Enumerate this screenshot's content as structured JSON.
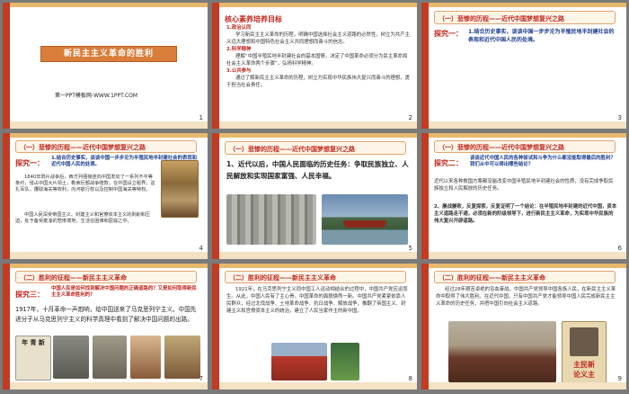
{
  "slides": [
    {
      "num": "1",
      "title": "新民主主义革命的胜利",
      "site": "第一PPT模板网-WWW.1PPT.COM"
    },
    {
      "num": "2",
      "heading": "核心素养培养目标",
      "s1_title": "1.政治认同",
      "s1_body": "学习新民主主义革命的历程，明确中国选择社会主义道路的必然性，树立为共产主义远大理想和中国特色社会主义共同理想而奋斗的信念。",
      "s2_title": "2.科学精神",
      "s2_body": "理解“中国半殖民地半封建社会的基本国情，决定了中国革命必须分为民主革命和社会主义革命两个步骤”，弘扬科学精神。",
      "s3_title": "3.公共参与",
      "s3_body": "通过了解新民主主义革命的历程，树立为实现中华民族伟大复兴而奋斗的理想，勇于担当社会责任。"
    },
    {
      "num": "3",
      "heading": "（一）悲惨的历程——近代中国梦想复兴之路",
      "explore": "探究一：",
      "question": "1.结合历史事实，谈谈中国一步步沦为半殖民地半封建社会的表现和近代中国人民的处境。"
    },
    {
      "num": "4",
      "heading": "（一）悲惨的历程——近代中国梦想复兴之路",
      "explore": "探究一：",
      "question": "1.结合历史事实，谈谈中国一步步沦为半殖民地半封建社会的表现和近代中国人民的处境。",
      "body1": "1840年鸦片战争后，西方列强接连向中国发动了一系列不平等条约，侵占中国大片领土，勒索巨额战争赔款，在中国设立租界，驻扎军队，攫取海关等权利，内河航行权以及控制中国海关等特权。",
      "body2": "中国人民深受帝国主义、封建主义和官僚资本主义的剥削和压迫，处于备受欺凌的悲惨境地，生活在困难和屈辱之中。"
    },
    {
      "num": "5",
      "heading": "（一）悲惨的历程——近代中国梦想复兴之路",
      "body": "1、近代以后，中国人民面临的历史任务：争取民族独立、人民解放和实现国家富强、人民幸福。"
    },
    {
      "num": "6",
      "heading": "（一）悲惨的历程——近代中国梦想复兴之路",
      "explore": "探究二：",
      "question": "谈谈近代中国人民的各种尝试和斗争为什么都没能取得最后的胜利？我们从中可以得出哪些结论？",
      "body": "近代以来各种救国方案都没能改变中国半殖民地半封建社会的性质，没有完成争取民族独立和人民解放的历史任务。",
      "point2": "2、屡战屡败，反复探索，反复证明了一个结论：在半殖民地半封建的近代中国，资本主义道路走不通，必须在新的阶级领导下，进行新民主主义革命，为实现中华民族的伟大复兴开辟道路。"
    },
    {
      "num": "7",
      "heading": "（二）胜利的征程——新民主主义革命",
      "explore": "探究三：",
      "question": "中国人民是如何找到解决中国问题的正确道路的？又是如何取得新民主主义革命胜利的？",
      "body": "1917年，十月革命一声炮响，给中国送来了马克思列宁主义。中国先进分子从马克思列宁主义的科学真理中看到了解决中国问题的出路。",
      "paper_title": "年 青 新"
    },
    {
      "num": "8",
      "heading": "（二）胜利的征程——新民主主义革命",
      "body": "1921年，在马克思列宁主义同中国工人运动相结合的过程中，中国共产党应运而生。从此，中国人民有了主心骨，中国革命的面貌焕然一新。中国共产党紧紧依靠人民群众，经过北伐战争、土地革命战争、抗日战争、解放战争，推翻了帝国主义、封建主义和官僚资本主义的统治，建立了人民当家作主的新中国。"
    },
    {
      "num": "9",
      "heading": "（二）胜利的征程——新民主主义革命",
      "body": "经过28年艰苦卓绝的浴血奋战，中国共产党领导中国各族人民，在新民主主义革命中取得了伟大胜利。在近代中国，只有中国共产党才能领导中国人民完成新民主主义革命的历史任务，并把中国引向社会主义道路。",
      "sign_line1": "主民新",
      "sign_line2": "论义主"
    }
  ],
  "colors": {
    "accent": "#c0281e",
    "blue": "#1c3d8e",
    "gold": "#e8b86d",
    "tan": "#f3e2c4",
    "bg": "#7a7a7a"
  }
}
